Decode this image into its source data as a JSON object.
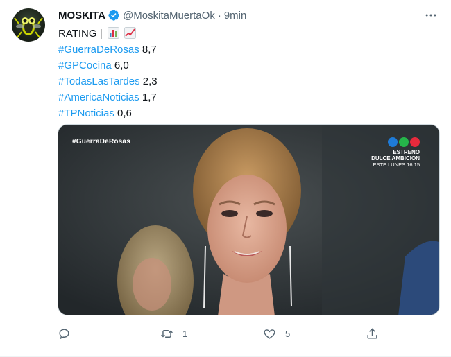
{
  "author": {
    "name": "MOSKITA",
    "handle": "@MoskitaMuertaOk",
    "separator": "·",
    "time": "9min",
    "verified": true
  },
  "tweet": {
    "header_line": "RATING |",
    "header_emojis": [
      "bar-chart-emoji",
      "chart-increasing-emoji"
    ],
    "ratings": [
      {
        "tag": "#GuerraDeRosas",
        "value": "8,7"
      },
      {
        "tag": "#GPCocina",
        "value": "6,0"
      },
      {
        "tag": "#TodasLasTardes",
        "value": "2,3"
      },
      {
        "tag": "#AmericaNoticias",
        "value": "1,7"
      },
      {
        "tag": "#TPNoticias",
        "value": "0,6"
      }
    ]
  },
  "media": {
    "overlay_tag": "#GuerraDeRosas",
    "promo": {
      "line1": "ESTRENO",
      "line2": "DULCE AMBICION",
      "line3": "ESTE LUNES 16.15"
    },
    "logo_colors": [
      "#1e7bd8",
      "#25b54a",
      "#e62a3c"
    ]
  },
  "actions": {
    "reply_count": "",
    "retweet_count": "1",
    "like_count": "5",
    "share_count": ""
  },
  "colors": {
    "link": "#1d9bf0",
    "muted": "#536471",
    "verified": "#1d9bf0"
  }
}
